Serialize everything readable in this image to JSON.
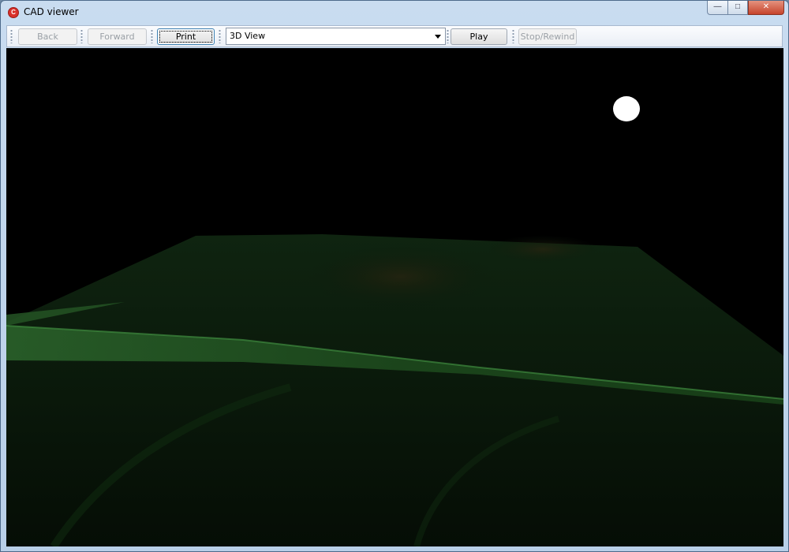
{
  "window": {
    "title": "CAD viewer",
    "app_icon_glyph": "C",
    "caption": {
      "minimize_glyph": "—",
      "maximize_glyph": "□",
      "close_glyph": "✕"
    }
  },
  "toolbar": {
    "back_label": "Back",
    "forward_label": "Forward",
    "print_label": "Print",
    "view_select": {
      "selected": "3D View"
    },
    "play_label": "Play",
    "stop_rewind_label": "Stop/Rewind"
  },
  "viewport": {
    "scene": "3d-terrain",
    "background_color": "#000000",
    "terrain_color": "#1e4a1e",
    "light_source_color": "#ffffff"
  }
}
